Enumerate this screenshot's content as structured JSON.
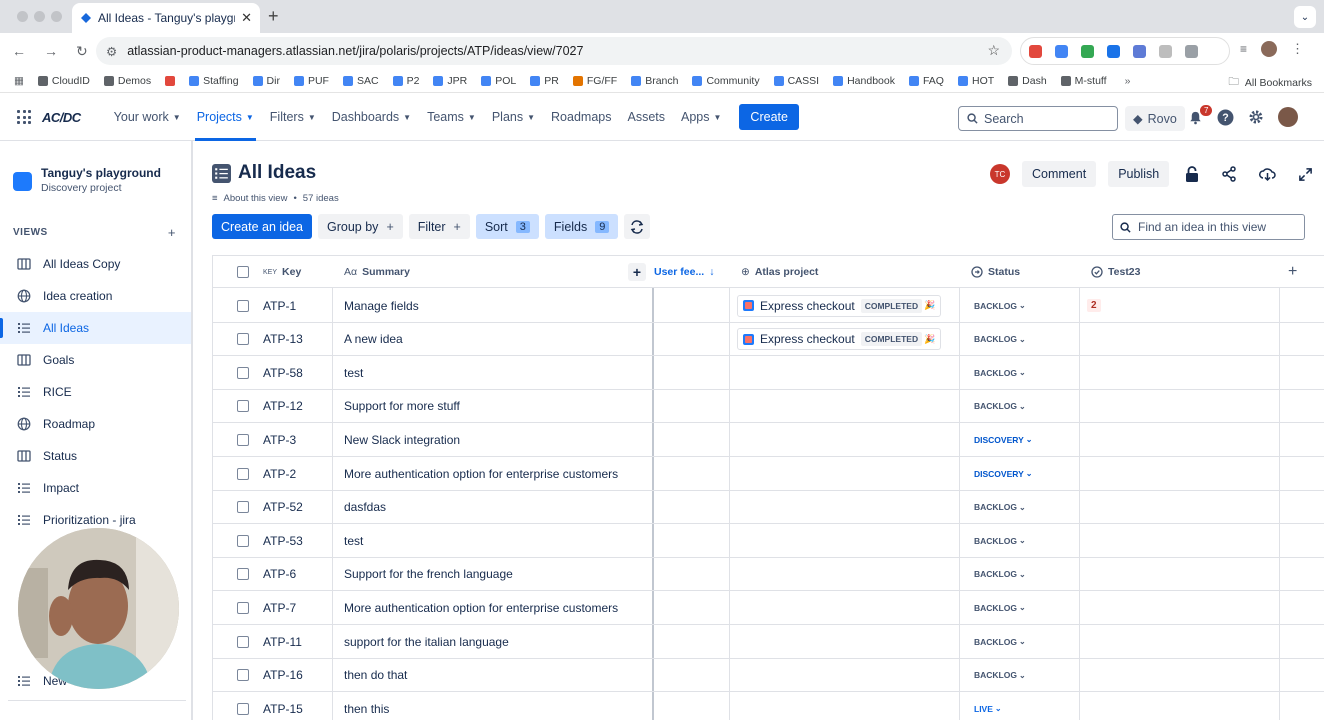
{
  "browser": {
    "tab_title": "All Ideas - Tanguy's playground",
    "url": "atlassian-product-managers.atlassian.net/jira/polaris/projects/ATP/ideas/view/7027",
    "bookmarks": [
      "CloudID",
      "Demos",
      "",
      "Staffing",
      "Dir",
      "PUF",
      "SAC",
      "P2",
      "JPR",
      "POL",
      "PR",
      "FG/FF",
      "Branch",
      "Community",
      "CASSI",
      "Handbook",
      "FAQ",
      "HOT",
      "Dash",
      "M-stuff"
    ],
    "all_bookmarks": "All Bookmarks",
    "bookmark_colors": [
      "#5f6368",
      "#5f6368",
      "#e2483d",
      "#4285f4",
      "#4285f4",
      "#4285f4",
      "#4285f4",
      "#4285f4",
      "#4285f4",
      "#4285f4",
      "#4285f4",
      "#e37400",
      "#4285f4",
      "#4285f4",
      "#4285f4",
      "#4285f4",
      "#4285f4",
      "#4285f4",
      "#5f6368",
      "#5f6368"
    ]
  },
  "nav": {
    "logo": "AC/DC",
    "menu": [
      {
        "label": "Your work",
        "chevron": true,
        "active": false
      },
      {
        "label": "Projects",
        "chevron": true,
        "active": true
      },
      {
        "label": "Filters",
        "chevron": true,
        "active": false
      },
      {
        "label": "Dashboards",
        "chevron": true,
        "active": false
      },
      {
        "label": "Teams",
        "chevron": true,
        "active": false
      },
      {
        "label": "Plans",
        "chevron": true,
        "active": false
      },
      {
        "label": "Roadmaps",
        "chevron": false,
        "active": false
      },
      {
        "label": "Assets",
        "chevron": false,
        "active": false
      },
      {
        "label": "Apps",
        "chevron": true,
        "active": false
      }
    ],
    "create_label": "Create",
    "search_placeholder": "Search",
    "rovo_label": "Rovo",
    "notification_count": "7"
  },
  "sidebar": {
    "project_name": "Tanguy's playground",
    "project_type": "Discovery project",
    "views_label": "VIEWS",
    "items": [
      {
        "label": "All Ideas Copy",
        "icon": "board-icon",
        "selected": false
      },
      {
        "label": "Idea creation",
        "icon": "globe-icon",
        "selected": false
      },
      {
        "label": "All Ideas",
        "icon": "list-icon",
        "selected": true
      },
      {
        "label": "Goals",
        "icon": "board-icon",
        "selected": false
      },
      {
        "label": "RICE",
        "icon": "list-icon",
        "selected": false
      },
      {
        "label": "Roadmap",
        "icon": "globe-icon",
        "selected": false
      },
      {
        "label": "Status",
        "icon": "board-icon",
        "selected": false
      },
      {
        "label": "Impact",
        "icon": "list-icon",
        "selected": false
      },
      {
        "label": "Prioritization - jira",
        "icon": "list-icon",
        "selected": false
      }
    ],
    "bottom_item": "New"
  },
  "main": {
    "title": "All Ideas",
    "about": "About this view",
    "ideas_count": "57 ideas",
    "avatar_initials": "TC",
    "comment_label": "Comment",
    "publish_label": "Publish",
    "toolbar": {
      "create_idea": "Create an idea",
      "group_by": "Group by",
      "filter": "Filter",
      "sort": "Sort",
      "sort_count": "3",
      "fields": "Fields",
      "fields_count": "9"
    },
    "find_placeholder": "Find an idea in this view"
  },
  "table": {
    "key_prefix": "KEY",
    "columns": {
      "key": "Key",
      "summary": "Summary",
      "user_feedback": "User fee...",
      "atlas": "Atlas project",
      "status": "Status",
      "test23": "Test23"
    },
    "rows": [
      {
        "key": "ATP-1",
        "summary": "Manage fields",
        "atlas": "Express checkout",
        "atlas_status": "COMPLETED",
        "status": "BACKLOG",
        "test23": "2"
      },
      {
        "key": "ATP-13",
        "summary": "A new idea",
        "atlas": "Express checkout",
        "atlas_status": "COMPLETED",
        "status": "BACKLOG",
        "test23": ""
      },
      {
        "key": "ATP-58",
        "summary": "test",
        "atlas": "",
        "atlas_status": "",
        "status": "BACKLOG",
        "test23": ""
      },
      {
        "key": "ATP-12",
        "summary": "Support for more stuff",
        "atlas": "",
        "atlas_status": "",
        "status": "BACKLOG",
        "test23": ""
      },
      {
        "key": "ATP-3",
        "summary": "New Slack integration",
        "atlas": "",
        "atlas_status": "",
        "status": "DISCOVERY",
        "test23": ""
      },
      {
        "key": "ATP-2",
        "summary": "More authentication option for enterprise customers",
        "atlas": "",
        "atlas_status": "",
        "status": "DISCOVERY",
        "test23": ""
      },
      {
        "key": "ATP-52",
        "summary": "dasfdas",
        "atlas": "",
        "atlas_status": "",
        "status": "BACKLOG",
        "test23": ""
      },
      {
        "key": "ATP-53",
        "summary": "test",
        "atlas": "",
        "atlas_status": "",
        "status": "BACKLOG",
        "test23": ""
      },
      {
        "key": "ATP-6",
        "summary": "Support for the french language",
        "atlas": "",
        "atlas_status": "",
        "status": "BACKLOG",
        "test23": ""
      },
      {
        "key": "ATP-7",
        "summary": "More authentication option for enterprise customers",
        "atlas": "",
        "atlas_status": "",
        "status": "BACKLOG",
        "test23": ""
      },
      {
        "key": "ATP-11",
        "summary": "support for the italian language",
        "atlas": "",
        "atlas_status": "",
        "status": "BACKLOG",
        "test23": ""
      },
      {
        "key": "ATP-16",
        "summary": "then do that",
        "atlas": "",
        "atlas_status": "",
        "status": "BACKLOG",
        "test23": ""
      },
      {
        "key": "ATP-15",
        "summary": "then this",
        "atlas": "",
        "atlas_status": "",
        "status": "LIVE",
        "test23": ""
      }
    ]
  },
  "colors": {
    "accent": "#0c66e4",
    "selected_bg": "#e9f2ff",
    "text": "#172b4d",
    "subtle": "#44546f"
  }
}
